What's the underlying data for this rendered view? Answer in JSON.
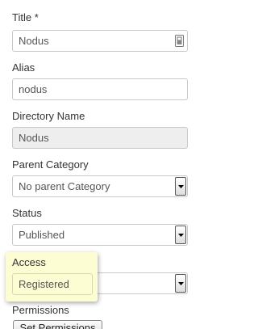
{
  "form": {
    "title": {
      "label": "Title *",
      "value": "Nodus"
    },
    "alias": {
      "label": "Alias",
      "value": "nodus"
    },
    "directory_name": {
      "label": "Directory Name",
      "value": "Nodus"
    },
    "parent_category": {
      "label": "Parent Category",
      "value": "No parent Category"
    },
    "status": {
      "label": "Status",
      "value": "Published"
    },
    "access": {
      "label": "Access",
      "value": "Registered"
    },
    "permissions": {
      "label": "Permissions",
      "button_label": "Set Permissions"
    }
  },
  "icons": {
    "title_field_icon": "lock-icon",
    "select_arrow_icon": "chevron-down-icon"
  },
  "colors": {
    "tooltip_background": "#fdfdd4",
    "readonly_background": "#eeeeee"
  }
}
